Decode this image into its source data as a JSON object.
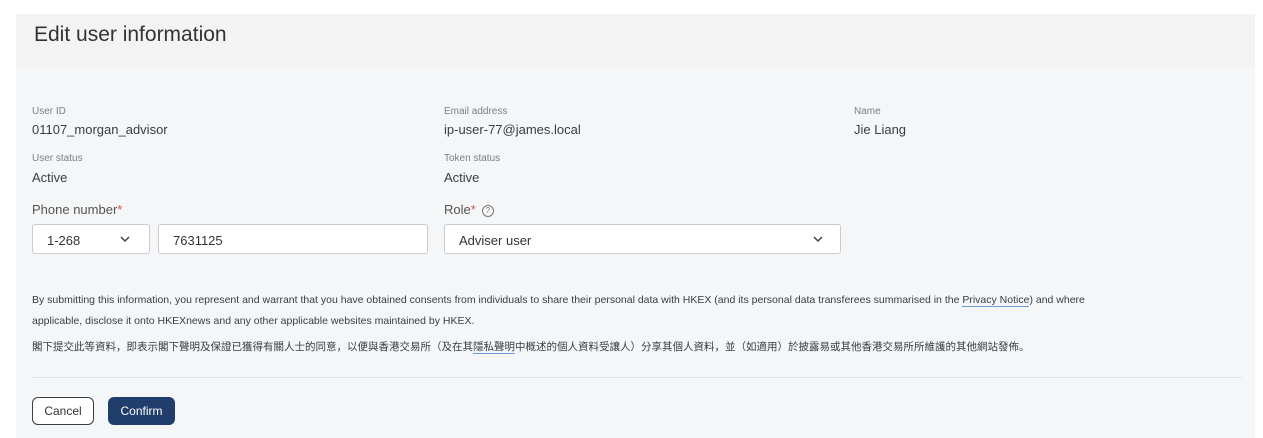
{
  "header": {
    "title": "Edit user information"
  },
  "fields": {
    "user_id": {
      "label": "User ID",
      "value": "01107_morgan_advisor"
    },
    "email": {
      "label": "Email address",
      "value": "ip-user-77@james.local"
    },
    "name": {
      "label": "Name",
      "value": "Jie Liang"
    },
    "user_status": {
      "label": "User status",
      "value": "Active"
    },
    "token_status": {
      "label": "Token status",
      "value": "Active"
    }
  },
  "phone": {
    "label": "Phone number",
    "required_mark": "*",
    "country_code": "1-268",
    "number": "7631125"
  },
  "role": {
    "label": "Role",
    "required_mark": "*",
    "selected": "Adviser user"
  },
  "disclaimer": {
    "en_part1": "By submitting this information, you represent and warrant that you have obtained consents from individuals to share their personal data with HKEX (and its personal data transferees summarised in the ",
    "en_link": "Privacy Notice",
    "en_part2": ") and where",
    "en_line2": "applicable, disclose it onto HKEXnews and any other applicable websites maintained by HKEX.",
    "zh_part1": "閣下提交此等資料，即表示閣下聲明及保證已獲得有關人士的同意，以便與香港交易所（及在其",
    "zh_link": "隱私聲明",
    "zh_part2": "中概述的個人資料受讓人）分享其個人資料，並（如適用）於披露易或其他香港交易所所維護的其他網站發佈。"
  },
  "actions": {
    "cancel_label": "Cancel",
    "confirm_label": "Confirm"
  },
  "icons": {
    "dropdown": "chevron-down-icon",
    "help": "question-circle-icon"
  },
  "colors": {
    "primary": "#203d6b",
    "required": "#d9534f",
    "link_underline": "#6a9bd1"
  }
}
